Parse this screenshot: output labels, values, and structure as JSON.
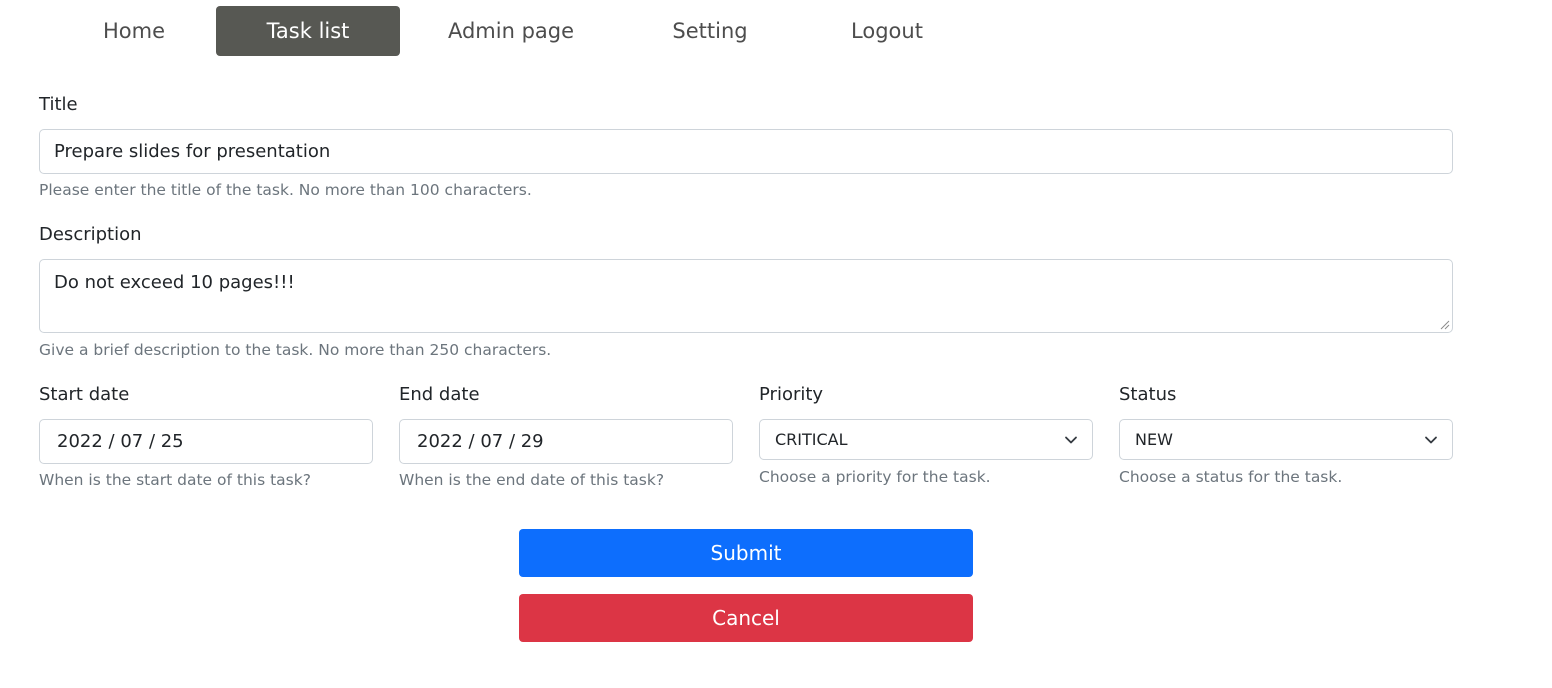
{
  "nav": {
    "items": [
      {
        "label": "Home"
      },
      {
        "label": "Task list",
        "active": true
      },
      {
        "label": "Admin page"
      },
      {
        "label": "Setting"
      },
      {
        "label": "Logout"
      }
    ],
    "active_color": "#575853"
  },
  "form": {
    "title": {
      "label": "Title",
      "value": "Prepare slides for presentation",
      "help": "Please enter the title of the task. No more than 100 characters."
    },
    "description": {
      "label": "Description",
      "value": "Do not exceed 10 pages!!!",
      "help": "Give a brief description to the task. No more than 250 characters."
    },
    "start_date": {
      "label": "Start date",
      "value": "2022 / 07 / 25",
      "help": "When is the start date of this task?"
    },
    "end_date": {
      "label": "End date",
      "value": "2022 / 07 / 29",
      "help": "When is the end date of this task?"
    },
    "priority": {
      "label": "Priority",
      "selected": "CRITICAL",
      "help": "Choose a priority for the task.",
      "icon": "chevron-down-icon"
    },
    "status": {
      "label": "Status",
      "selected": "NEW",
      "help": "Choose a status for the task.",
      "icon": "chevron-down-icon"
    }
  },
  "buttons": {
    "submit": {
      "label": "Submit",
      "color": "#0d6efd"
    },
    "cancel": {
      "label": "Cancel",
      "color": "#dc3545"
    }
  }
}
